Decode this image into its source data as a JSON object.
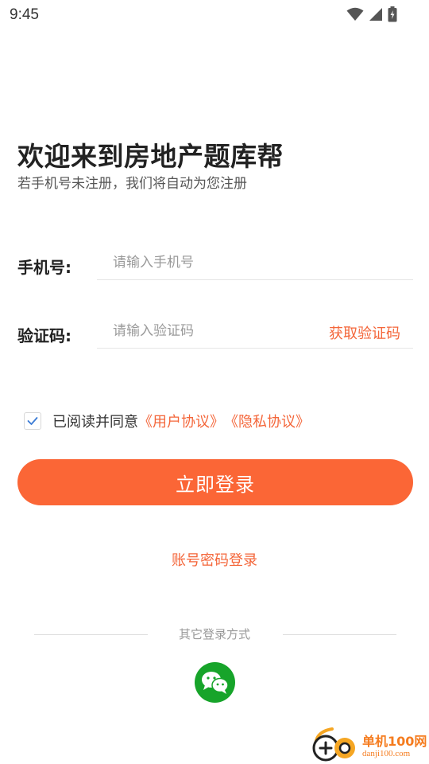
{
  "status_bar": {
    "time": "9:45"
  },
  "header": {
    "title": "欢迎来到房地产题库帮",
    "subtitle": "若手机号未注册，我们将自动为您注册"
  },
  "form": {
    "phone_label": "手机号:",
    "phone_placeholder": "请输入手机号",
    "phone_value": "",
    "code_label": "验证码:",
    "code_placeholder": "请输入验证码",
    "code_value": "",
    "get_code_label": "获取验证码"
  },
  "agreement": {
    "checked": true,
    "prefix": "已阅读并同意",
    "user_agreement": "《用户协议》",
    "privacy_policy": "《隐私协议》"
  },
  "actions": {
    "login_label": "立即登录",
    "password_login_label": "账号密码登录"
  },
  "other_login": {
    "label": "其它登录方式",
    "methods": [
      "wechat-icon"
    ]
  },
  "watermark": {
    "name": "单机100网",
    "domain": "danji100.com"
  },
  "colors": {
    "accent": "#fb6636",
    "link": "#f4663a",
    "wechat": "#17a42a",
    "checkbox_mark": "#3a7bd5"
  }
}
